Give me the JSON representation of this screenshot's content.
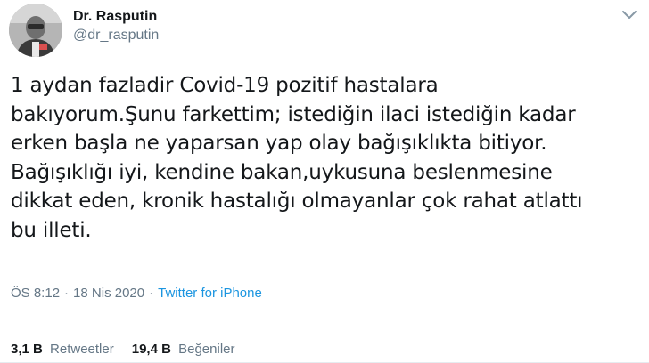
{
  "user": {
    "display_name": "Dr. Rasputin",
    "handle": "@dr_rasputin"
  },
  "tweet": {
    "lines": [
      "1 aydan fazladir Covid-19 pozitif hastalara",
      "bakıyorum.Şunu farkettim; istediğin ilaci istediğin kadar",
      "erken başla ne yaparsan yap olay bağışıklıkta bitiyor.",
      "Bağışıklığı iyi, kendine bakan,uykusuna beslenmesine",
      "dikkat eden, kronik hastalığı olmayanlar çok rahat atlattı",
      "bu illeti."
    ],
    "time": "ÖS 8:12",
    "separator": "·",
    "date": "18 Nis 2020",
    "source": "Twitter for iPhone"
  },
  "stats": {
    "retweets_count": "3,1 B",
    "retweets_label": "Retweetler",
    "likes_count": "19,4 B",
    "likes_label": "Beğeniler"
  },
  "icons": {
    "menu": "chevron-down-icon"
  },
  "colors": {
    "link": "#1b95e0",
    "secondary": "#657786",
    "primary": "#14171a",
    "divider": "#e6ecf0"
  }
}
